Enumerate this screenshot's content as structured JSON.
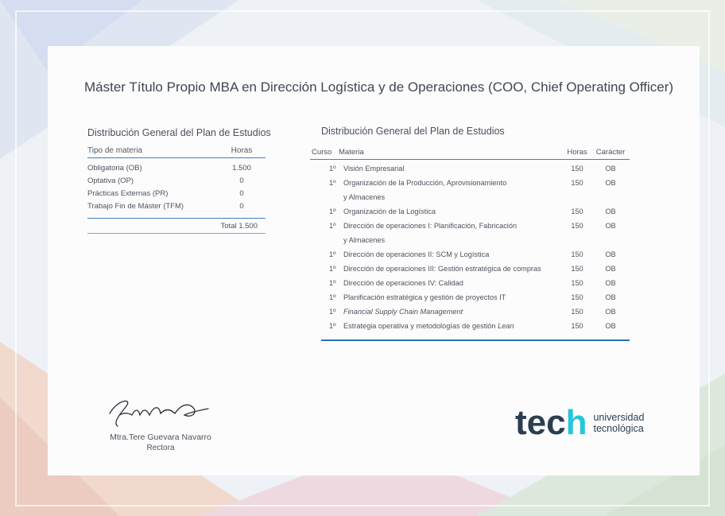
{
  "title": "Máster Título Propio MBA en Dirección Logística y de Operaciones (COO, Chief Operating Officer)",
  "summary": {
    "heading": "Distribución General del Plan de Estudios",
    "col_type": "Tipo de materia",
    "col_hours": "Horas",
    "rows": [
      {
        "type": "Obligatoria (OB)",
        "hours": "1.500"
      },
      {
        "type": "Optativa (OP)",
        "hours": "0"
      },
      {
        "type": "Prácticas Externas (PR)",
        "hours": "0"
      },
      {
        "type": "Trabajo Fin de Máster (TFM)",
        "hours": "0"
      }
    ],
    "total": "Total 1.500"
  },
  "plan": {
    "heading": "Distribución General del Plan de Estudios",
    "col_course": "Curso",
    "col_subject": "Materia",
    "col_hours": "Horas",
    "col_type": "Carácter",
    "rows": [
      {
        "course": "1º",
        "subject": "Visión Empresarial",
        "cont": "",
        "hours": "150",
        "type": "OB"
      },
      {
        "course": "1º",
        "subject": "Organización de la Producción, Aprovisionamiento",
        "cont": "y Almacenes",
        "hours": "150",
        "type": "OB"
      },
      {
        "course": "1º",
        "subject": "Organización de la Logística",
        "cont": "",
        "hours": "150",
        "type": "OB"
      },
      {
        "course": "1º",
        "subject": "Dirección de operaciones I: Planificación, Fabricación",
        "cont": "y Almacenes",
        "hours": "150",
        "type": "OB"
      },
      {
        "course": "1º",
        "subject": "Dirección de operaciones II: SCM y Logística",
        "cont": "",
        "hours": "150",
        "type": "OB"
      },
      {
        "course": "1º",
        "subject": "Dirección de operaciones III: Gestión estratégica de compras",
        "cont": "",
        "hours": "150",
        "type": "OB"
      },
      {
        "course": "1º",
        "subject": "Dirección de operaciones IV: Calidad",
        "cont": "",
        "hours": "150",
        "type": "OB"
      },
      {
        "course": "1º",
        "subject": "Planificación estratégica y gestión de proyectos IT",
        "cont": "",
        "hours": "150",
        "type": "OB"
      },
      {
        "course": "1º",
        "subject": "Financial Supply Chain Management",
        "cont": "",
        "hours": "150",
        "type": "OB"
      },
      {
        "course": "1º",
        "subject": "Estrategia operativa y metodologías de gestión Lean",
        "cont": "",
        "hours": "150",
        "type": "OB"
      }
    ]
  },
  "signature": {
    "name": "Mtra.Tere Guevara Navarro",
    "role": "Rectora"
  },
  "logo": {
    "word": "tec",
    "glyph": "h",
    "line1": "universidad",
    "line2": "tecnológica"
  },
  "colors": {
    "accent": "#3f7fc0",
    "brand_dark": "#2b3e50",
    "brand_cyan": "#27c6d9"
  }
}
